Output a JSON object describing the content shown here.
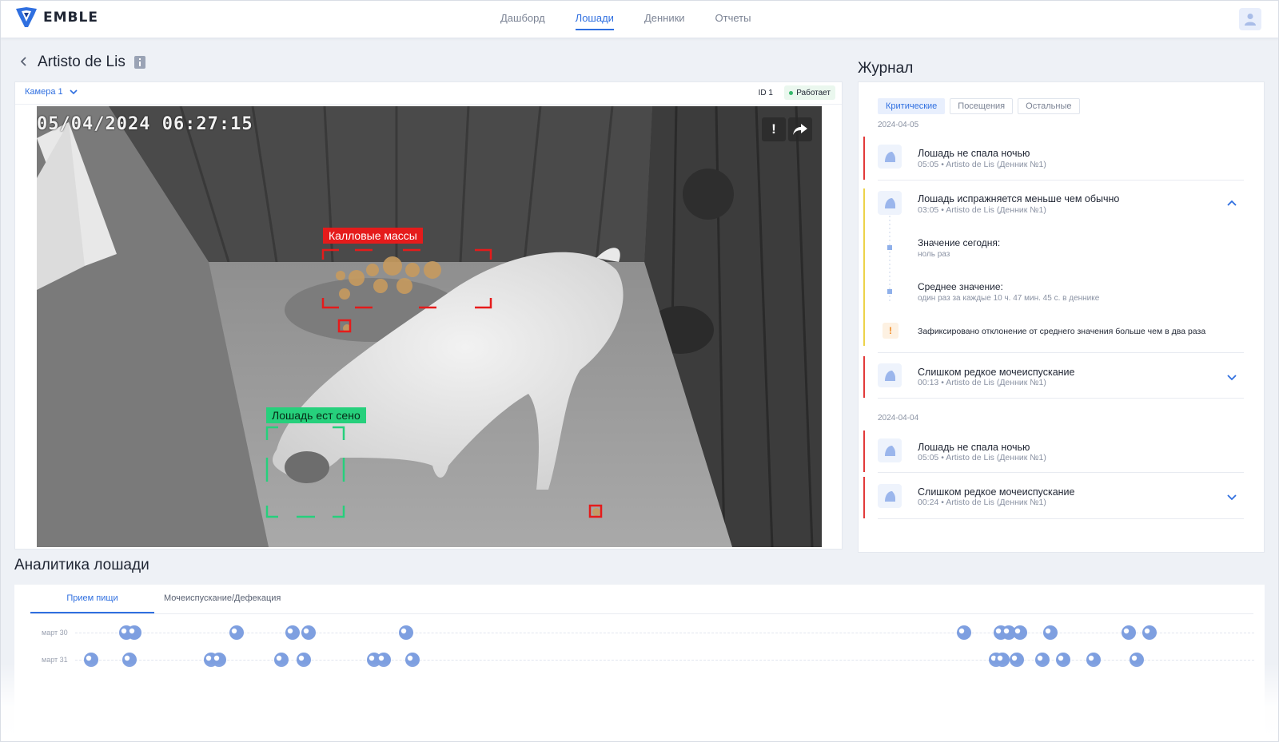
{
  "brand": {
    "name": "EMBLE",
    "logo_icon": "shield-logo-icon"
  },
  "nav": [
    {
      "label": "Дашборд",
      "active": false
    },
    {
      "label": "Лошади",
      "active": true
    },
    {
      "label": "Денники",
      "active": false
    },
    {
      "label": "Отчеты",
      "active": false
    }
  ],
  "header": {
    "horse_name": "Artisto de Lis"
  },
  "camera": {
    "selected": "Камера 1",
    "id_label": "ID 1",
    "status": "Работает",
    "timestamp": "05/04/2024 06:27:15",
    "detections": [
      {
        "label": "Калловые массы",
        "color": "#e51b1b"
      },
      {
        "label": "Лошадь ест сено",
        "color": "#26d07c"
      }
    ]
  },
  "journal": {
    "title": "Журнал",
    "tabs": [
      {
        "label": "Критические",
        "active": true
      },
      {
        "label": "Посещения",
        "active": false
      },
      {
        "label": "Остальные",
        "active": false
      }
    ],
    "groups": [
      {
        "date": "2024-04-05",
        "items": [
          {
            "title": "Лошадь не спала ночью",
            "meta": "05:05 • Artisto de Lis (Денник №1)",
            "severity": "critical"
          },
          {
            "title": "Лошадь испражняется меньше чем обычно",
            "meta": "03:05 • Artisto de Lis (Денник №1)",
            "severity": "warning",
            "expanded": true,
            "details": [
              {
                "label": "Значение сегодня:",
                "value": "ноль раз"
              },
              {
                "label": "Среднее значение:",
                "value": "один раз за каждые 10 ч. 47 мин. 45 с. в деннике"
              }
            ],
            "alert": "Зафиксировано отклонение от среднего значения больше чем в два раза"
          },
          {
            "title": "Слишком редкое мочеиспускание",
            "meta": "00:13 • Artisto de Lis (Денник №1)",
            "severity": "critical"
          }
        ]
      },
      {
        "date": "2024-04-04",
        "items": [
          {
            "title": "Лошадь не спала ночью",
            "meta": "05:05 • Artisto de Lis (Денник №1)",
            "severity": "critical"
          },
          {
            "title": "Слишком редкое мочеиспускание",
            "meta": "00:24 • Artisto de Lis (Денник №1)",
            "severity": "critical"
          }
        ]
      }
    ]
  },
  "analytics": {
    "title": "Аналитика лошади",
    "tabs": [
      {
        "label": "Прием пищи",
        "active": true
      },
      {
        "label": "Мочеиспускание/Дефекация",
        "active": false
      }
    ],
    "rows": [
      {
        "label": "март 30"
      },
      {
        "label": "март 31"
      }
    ]
  },
  "colors": {
    "accent": "#2f6fe0",
    "critical": "#e23a3a",
    "warning": "#ecd34a"
  }
}
